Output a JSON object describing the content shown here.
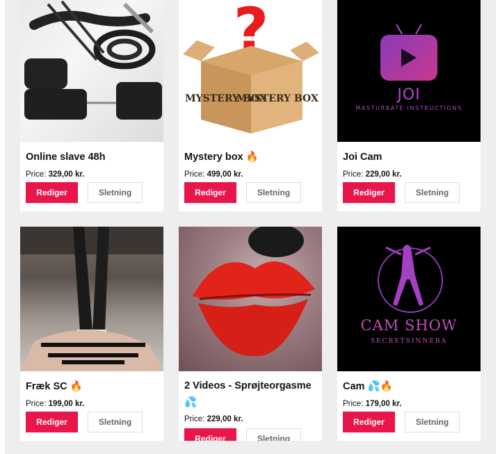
{
  "products": [
    {
      "title": "Online slave 48h",
      "emoji": "",
      "price_label": "Price:",
      "price": "329,00 kr.",
      "edit_label": "Rediger",
      "delete_label": "Sletning",
      "image": "bondage-gear-photo"
    },
    {
      "title": "Mystery box",
      "emoji": "🔥",
      "price_label": "Price:",
      "price": "499,00 kr.",
      "edit_label": "Rediger",
      "delete_label": "Sletning",
      "image": "mystery-box-graphic",
      "image_text": {
        "mark": "?",
        "box1": "MYSTERY BOX",
        "box2": "MYSTERY BOX"
      }
    },
    {
      "title": "Joi Cam",
      "emoji": "",
      "price_label": "Price:",
      "price": "229,00 kr.",
      "edit_label": "Rediger",
      "delete_label": "Sletning",
      "image": "joi-logo",
      "image_text": {
        "line1": "JOI",
        "line2": "MASTURBATE INSTRUCTIONS"
      }
    },
    {
      "title": "Fræk SC",
      "emoji": "🔥",
      "price_label": "Price:",
      "price": "199,00 kr.",
      "edit_label": "Rediger",
      "delete_label": "Sletning",
      "image": "stockings-photo"
    },
    {
      "title": "2 Videos - Sprøjteorgasme",
      "emoji": "💦",
      "price_label": "Price:",
      "price": "229,00 kr.",
      "edit_label": "Rediger",
      "delete_label": "Sletning",
      "image": "lips-photo"
    },
    {
      "title": "Cam",
      "emoji": "💦🔥",
      "price_label": "Price:",
      "price": "179,00 kr.",
      "edit_label": "Rediger",
      "delete_label": "Sletning",
      "image": "cam-show-logo",
      "image_text": {
        "line1": "CAM SHOW",
        "line2": "SECRETSINNERA"
      }
    }
  ],
  "colors": {
    "edit_button": "#e8164a",
    "panel": "#eeeeee"
  }
}
